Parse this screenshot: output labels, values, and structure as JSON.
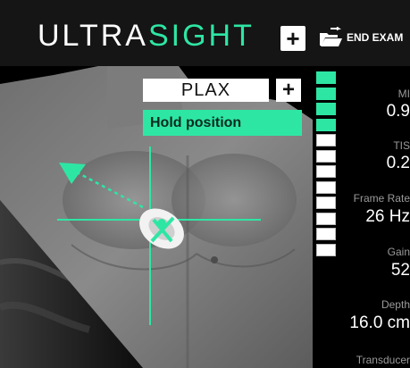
{
  "header": {
    "logo_part1": "ULTRA",
    "logo_part2": "SIGHT",
    "add_label": "+",
    "end_exam_label": "END EXAM"
  },
  "guidance": {
    "view_label": "PLAX",
    "view_add_label": "+",
    "instruction": "Hold position"
  },
  "quality_meter": {
    "total_segments": 12,
    "filled_segments": 4,
    "fill_color": "#2ee6a4"
  },
  "stats": [
    {
      "label": "MI",
      "value": "0.9"
    },
    {
      "label": "TIS",
      "value": "0.2"
    },
    {
      "label": "Frame Rate",
      "value": "26 Hz"
    },
    {
      "label": "Gain",
      "value": "52"
    },
    {
      "label": "Depth",
      "value": "16.0 cm"
    },
    {
      "label": "Transducer",
      "value": ""
    }
  ],
  "colors": {
    "accent": "#2ee6a4",
    "header_bg": "#151515"
  },
  "icons": [
    "plus-icon",
    "folder-open-icon",
    "guidance-arrow-icon",
    "probe-icon"
  ]
}
